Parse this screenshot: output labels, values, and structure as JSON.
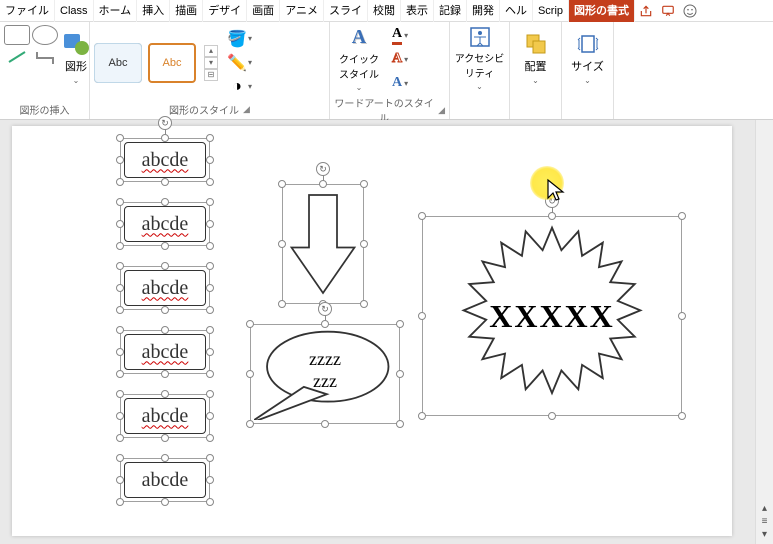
{
  "menu": {
    "tabs": [
      "ファイル",
      "Class",
      "ホーム",
      "挿入",
      "描画",
      "デザイ",
      "画面",
      "アニメ",
      "スライ",
      "校閲",
      "表示",
      "記録",
      "開発",
      "ヘル",
      "Scrip"
    ],
    "active_tab": "図形の書式"
  },
  "ribbon": {
    "insert_shapes": {
      "label": "図形の挿入",
      "big_btn": "図形"
    },
    "shape_styles": {
      "label": "図形のスタイル",
      "thumb_text": "Abc"
    },
    "quick_styles": {
      "label": "クイック\nスタイル",
      "glyph": "A"
    },
    "wordart": {
      "label": "ワードアートのスタイル",
      "glyph": "A"
    },
    "accessibility": {
      "label": "アクセシビ\nリティ"
    },
    "arrange": {
      "label": "配置"
    },
    "size": {
      "label": "サイズ"
    }
  },
  "canvas": {
    "rects": [
      {
        "text": "abcde"
      },
      {
        "text": "abcde"
      },
      {
        "text": "abcde"
      },
      {
        "text": "abcde"
      },
      {
        "text": "abcde"
      },
      {
        "text": "abcde"
      }
    ],
    "bubble_text": "zzzz\nzzz",
    "star_text": "XXXXX"
  }
}
